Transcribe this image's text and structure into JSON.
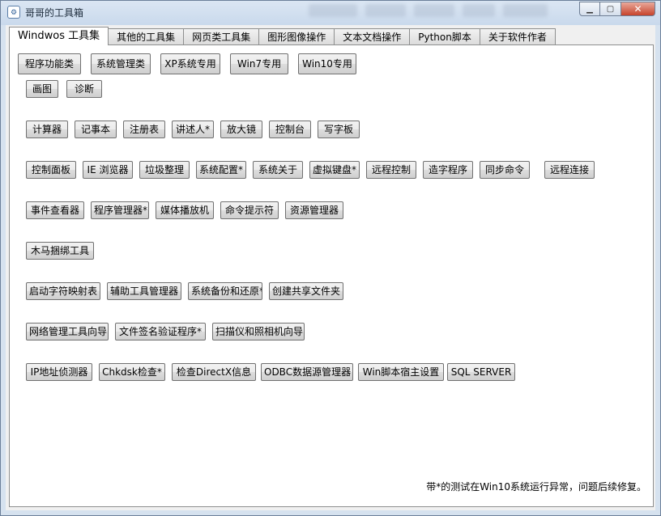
{
  "window": {
    "title": "哥哥的工具箱",
    "icon": "gear-icon"
  },
  "tabs": [
    "Windwos 工具集",
    "其他的工具集",
    "网页类工具集",
    "图形图像操作",
    "文本文档操作",
    "Python脚本",
    "关于软件作者"
  ],
  "top_buttons": [
    "程序功能类",
    "系统管理类",
    "XP系统专用",
    "Win7专用",
    "Win10专用"
  ],
  "row1": [
    "画图",
    "诊断"
  ],
  "row2": [
    "计算器",
    "记事本",
    "注册表",
    "讲述人*",
    "放大镜",
    "控制台",
    "写字板"
  ],
  "row3": [
    "控制面板",
    "IE 浏览器",
    "垃圾整理",
    "系统配置*",
    "系统关于",
    "虚拟键盘*",
    "远程控制",
    "造字程序",
    "同步命令",
    "远程连接"
  ],
  "row4": [
    "事件查看器",
    "程序管理器*",
    "媒体播放机",
    "命令提示符",
    "资源管理器"
  ],
  "row5": [
    "木马捆绑工具"
  ],
  "row6": [
    "启动字符映射表",
    "辅助工具管理器",
    "系统备份和还原*",
    "创建共享文件夹"
  ],
  "row7": [
    "网络管理工具向导",
    "文件签名验证程序*",
    "扫描仪和照相机向导"
  ],
  "row8": [
    "IP地址侦测器",
    "Chkdsk检查*",
    "检查DirectX信息",
    "ODBC数据源管理器",
    "Win脚本宿主设置",
    "SQL SERVER"
  ],
  "footer_note": "带*的测试在Win10系统运行异常，问题后续修复。"
}
